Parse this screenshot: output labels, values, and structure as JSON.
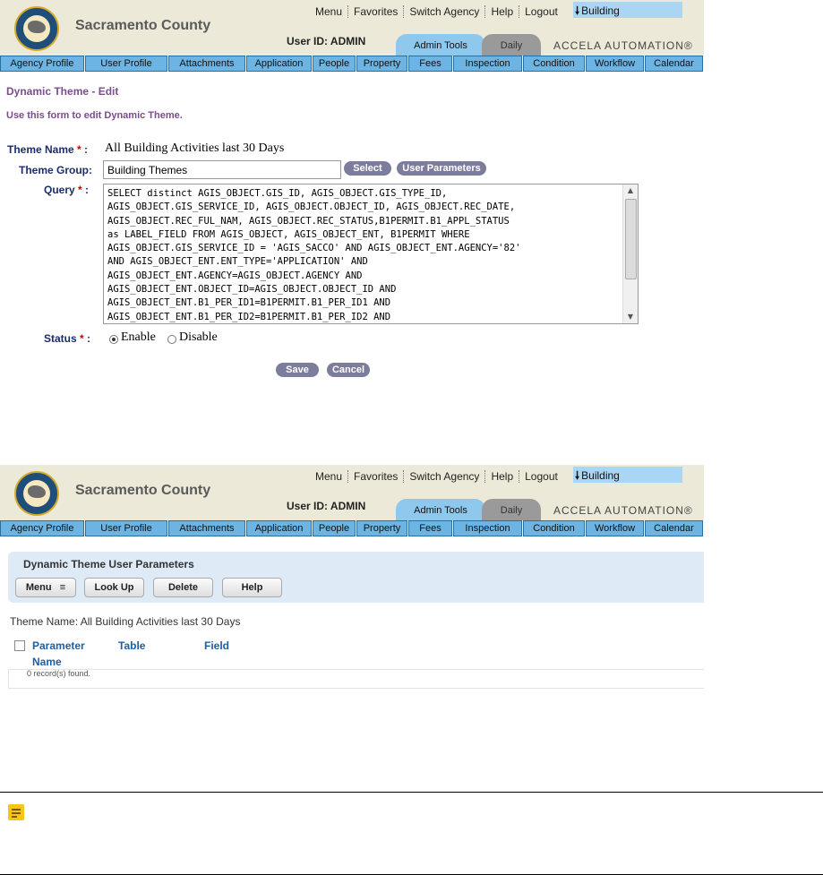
{
  "header": {
    "county": "Sacramento County",
    "menu": [
      "Menu",
      "Favorites",
      "Switch Agency",
      "Help",
      "Logout"
    ],
    "agency": "Building",
    "user_id": "User ID: ADMIN",
    "tab_admin": "Admin Tools",
    "tab_daily": "Daily",
    "brand": "ACCELA AUTOMATION®",
    "nav": [
      "Agency Profile",
      "User Profile",
      "Attachments",
      "Application",
      "People",
      "Property",
      "Fees",
      "Inspection",
      "Condition",
      "Workflow",
      "Calendar"
    ]
  },
  "edit": {
    "title": "Dynamic Theme - Edit",
    "description": "Use this form to edit Dynamic Theme.",
    "theme_name_label": "Theme Name",
    "theme_name": "All Building Activities last 30 Days",
    "theme_group_label": "Theme Group:",
    "theme_group": "Building Themes",
    "select_btn": "Select",
    "user_params_btn": "User Parameters",
    "query_label": "Query",
    "query": "SELECT distinct AGIS_OBJECT.GIS_ID, AGIS_OBJECT.GIS_TYPE_ID,\nAGIS_OBJECT.GIS_SERVICE_ID, AGIS_OBJECT.OBJECT_ID, AGIS_OBJECT.REC_DATE,\nAGIS_OBJECT.REC_FUL_NAM, AGIS_OBJECT.REC_STATUS,B1PERMIT.B1_APPL_STATUS\nas LABEL_FIELD FROM AGIS_OBJECT, AGIS_OBJECT_ENT, B1PERMIT WHERE\nAGIS_OBJECT.GIS_SERVICE_ID = 'AGIS_SACCO' AND AGIS_OBJECT_ENT.AGENCY='82'\nAND AGIS_OBJECT_ENT.ENT_TYPE='APPLICATION' AND\nAGIS_OBJECT_ENT.AGENCY=AGIS_OBJECT.AGENCY AND\nAGIS_OBJECT_ENT.OBJECT_ID=AGIS_OBJECT.OBJECT_ID AND\nAGIS_OBJECT_ENT.B1_PER_ID1=B1PERMIT.B1_PER_ID1 AND\nAGIS_OBJECT_ENT.B1_PER_ID2=B1PERMIT.B1_PER_ID2 AND",
    "status_label": "Status",
    "enable": "Enable",
    "disable": "Disable",
    "status_value": "Enable",
    "save_btn": "Save",
    "cancel_btn": "Cancel"
  },
  "params": {
    "title": "Dynamic Theme User Parameters",
    "menu_btn": "Menu",
    "lookup_btn": "Look Up",
    "delete_btn": "Delete",
    "help_btn": "Help",
    "theme_name_line": "Theme Name: All Building Activities last 30 Days",
    "col_param_1": "Parameter",
    "col_param_2": "Name",
    "col_table": "Table",
    "col_field": "Field",
    "records": "0 record(s) found."
  },
  "colors": {
    "nav_tab": "#6cb4e4",
    "admin_tab": "#8ec8ec",
    "form_label": "#1c2d6b",
    "page_title": "#7a4d8c",
    "pill_button": "#7c7c9c",
    "panel": "#deebf7",
    "column_header": "#1b5fa8",
    "required": "#cc0000"
  },
  "icons": [
    "download-arrow-icon",
    "seal-logo",
    "menu-caret-icon",
    "note-icon"
  ]
}
